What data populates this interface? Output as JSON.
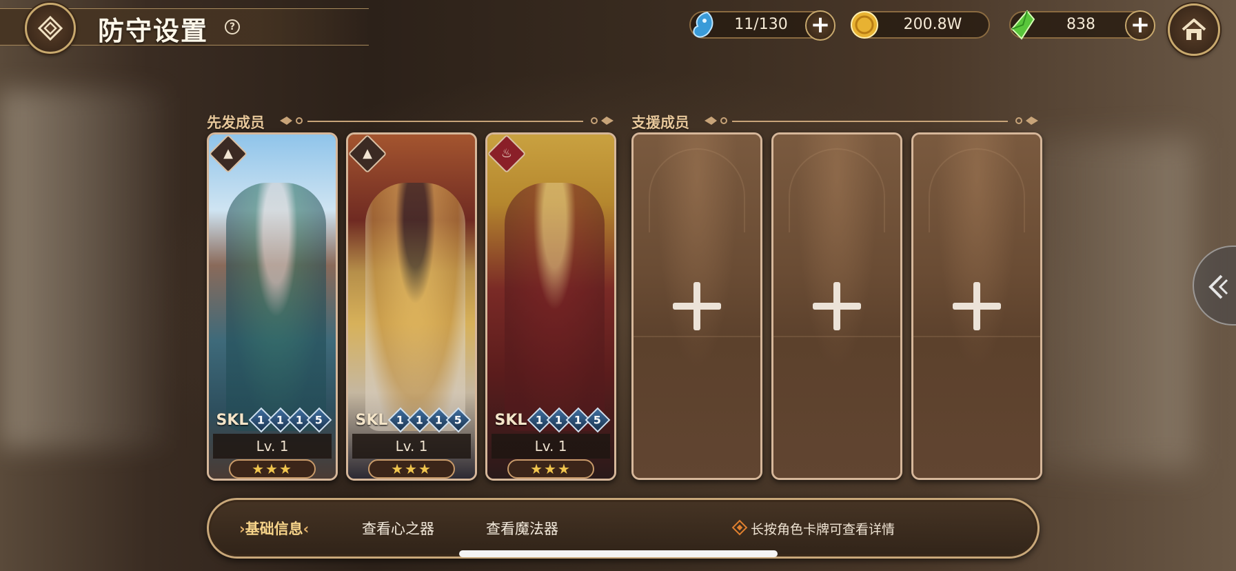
{
  "header": {
    "title": "防守设置",
    "help_icon": "question-circle-icon",
    "back_icon": "diamond-return-icon",
    "home_icon": "home-icon"
  },
  "resources": [
    {
      "name": "stamina",
      "icon": "water-spirit-icon",
      "value": "11/130",
      "has_plus": true
    },
    {
      "name": "gold",
      "icon": "gold-coin-icon",
      "value": "200.8W",
      "has_plus": false
    },
    {
      "name": "gem",
      "icon": "green-crystal-icon",
      "value": "838",
      "has_plus": true
    }
  ],
  "starter_section": {
    "label": "先发成员"
  },
  "support_section": {
    "label": "支援成员"
  },
  "starters": [
    {
      "element_icon": "mountain-element-icon",
      "skl_label": "SKL",
      "skills": [
        "1",
        "1",
        "1",
        "5"
      ],
      "level": "Lv. 1",
      "stars": "★★★"
    },
    {
      "element_icon": "mountain-element-icon",
      "skl_label": "SKL",
      "skills": [
        "1",
        "1",
        "1",
        "5"
      ],
      "level": "Lv. 1",
      "stars": "★★★"
    },
    {
      "element_icon": "fire-element-icon",
      "skl_label": "SKL",
      "skills": [
        "1",
        "1",
        "1",
        "5"
      ],
      "level": "Lv. 1",
      "stars": "★★★"
    }
  ],
  "support_slots": [
    {
      "state": "empty"
    },
    {
      "state": "empty"
    },
    {
      "state": "empty"
    }
  ],
  "tabs": [
    {
      "label": "基础信息",
      "active": true
    },
    {
      "label": "查看心之器",
      "active": false
    },
    {
      "label": "查看魔法器",
      "active": false
    }
  ],
  "hint": "长按角色卡牌可查看详情",
  "colors": {
    "frame_gold": "#c9a87a",
    "active_tab": "#f7d48a",
    "star": "#f0c54e"
  }
}
